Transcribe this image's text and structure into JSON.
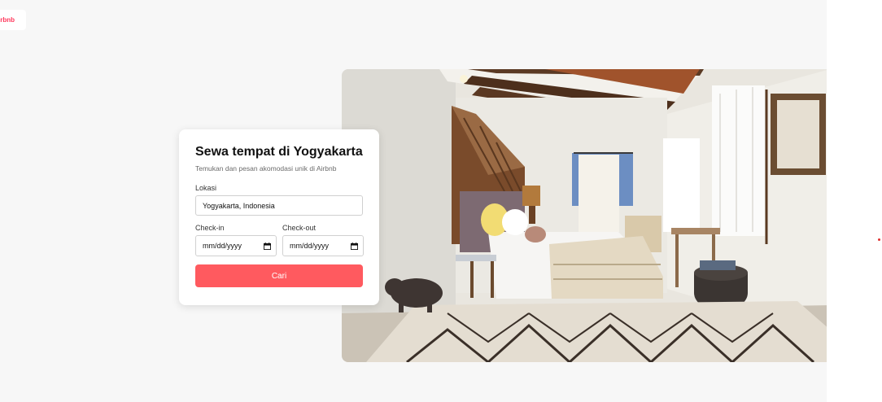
{
  "brand": {
    "logo_text": "Airbnb",
    "visible_logo_text": "irbnb",
    "accent_color": "#ff5a5f"
  },
  "search_card": {
    "title": "Sewa tempat di Yogyakarta",
    "subtitle": "Temukan dan pesan akomodasi unik di Airbnb",
    "location_label": "Lokasi",
    "location_value": "Yogyakarta, Indonesia",
    "checkin_label": "Check-in",
    "checkin_value": "mm/dd/yyyy",
    "checkout_label": "Check-out",
    "checkout_value": "mm/dd/yyyy",
    "search_button_label": "Cari",
    "calendar_icon": "calendar-icon"
  },
  "hero_image": {
    "subject": "bedroom-interior-photo"
  }
}
